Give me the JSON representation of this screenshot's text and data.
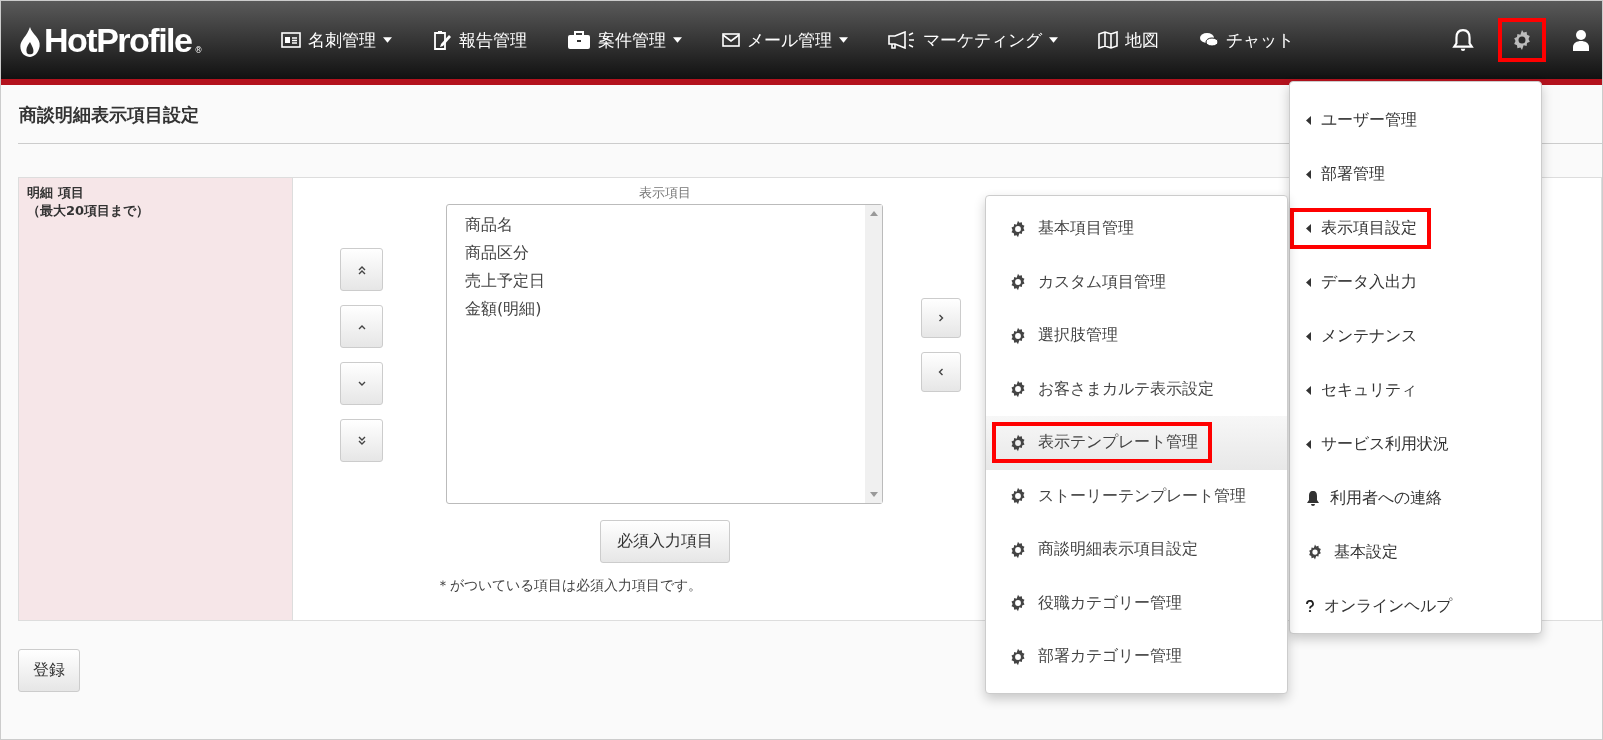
{
  "brand": {
    "name": "HotProfile",
    "mark": "®"
  },
  "nav": [
    {
      "kind": "card",
      "label": "名刺管理",
      "dropdown": true
    },
    {
      "kind": "clipboard",
      "label": "報告管理",
      "dropdown": false
    },
    {
      "kind": "briefcase",
      "label": "案件管理",
      "dropdown": true
    },
    {
      "kind": "envelope",
      "label": "メール管理",
      "dropdown": true
    },
    {
      "kind": "megaphone",
      "label": "マーケティング",
      "dropdown": true
    },
    {
      "kind": "map",
      "label": "地図",
      "dropdown": false
    },
    {
      "kind": "chat",
      "label": "チャット",
      "dropdown": false
    }
  ],
  "nav_icons": [
    {
      "kind": "bell",
      "callout": false
    },
    {
      "kind": "gear",
      "callout": true
    },
    {
      "kind": "user",
      "callout": false
    }
  ],
  "page_title": "商談明細表示項目設定",
  "form": {
    "label": "明細 項目",
    "label_note": "（最大20項目まで）",
    "displayed_header": "表示項目",
    "displayed_items": [
      "商品名",
      "商品区分",
      "売上予定日",
      "金額(明細)"
    ],
    "required_button": "必須入力項目",
    "note": "＊がついている項目は必須入力項目です。"
  },
  "submit_button": "登録",
  "settings_menu": [
    {
      "kind": "submenu",
      "label": "ユーザー管理",
      "callout": false
    },
    {
      "kind": "submenu",
      "label": "部署管理",
      "callout": false
    },
    {
      "kind": "submenu",
      "label": "表示項目設定",
      "callout": true
    },
    {
      "kind": "submenu",
      "label": "データ入出力",
      "callout": false
    },
    {
      "kind": "submenu",
      "label": "メンテナンス",
      "callout": false
    },
    {
      "kind": "submenu",
      "label": "セキュリティ",
      "callout": false
    },
    {
      "kind": "submenu",
      "label": "サービス利用状況",
      "callout": false
    },
    {
      "kind": "notice",
      "label": "利用者への連絡",
      "callout": false
    },
    {
      "kind": "setting",
      "label": "基本設定",
      "callout": false
    },
    {
      "kind": "help",
      "label": "オンラインヘルプ",
      "callout": false
    }
  ],
  "display_submenu": [
    {
      "label": "基本項目管理",
      "hovered": false,
      "callout": false
    },
    {
      "label": "カスタム項目管理",
      "hovered": false,
      "callout": false
    },
    {
      "label": "選択肢管理",
      "hovered": false,
      "callout": false
    },
    {
      "label": "お客さまカルテ表示設定",
      "hovered": false,
      "callout": false
    },
    {
      "label": "表示テンプレート管理",
      "hovered": true,
      "callout": true
    },
    {
      "label": "ストーリーテンプレート管理",
      "hovered": false,
      "callout": false
    },
    {
      "label": "商談明細表示項目設定",
      "hovered": false,
      "callout": false
    },
    {
      "label": "役職カテゴリー管理",
      "hovered": false,
      "callout": false
    },
    {
      "label": "部署カテゴリー管理",
      "hovered": false,
      "callout": false
    }
  ]
}
